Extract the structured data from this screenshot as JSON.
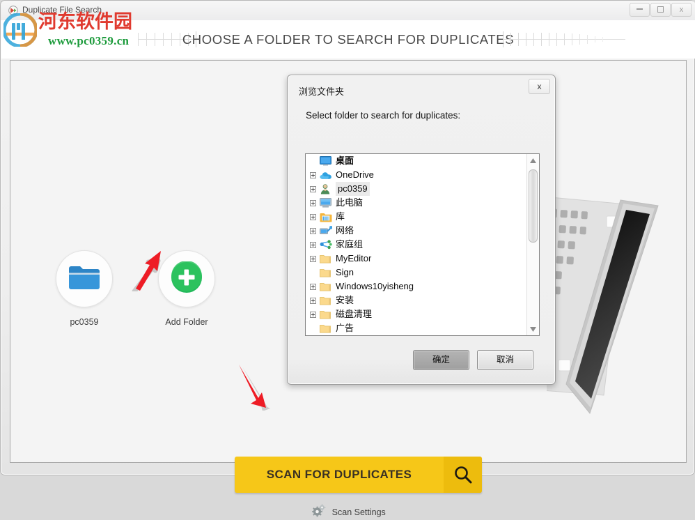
{
  "window": {
    "title": "Duplicate File Search",
    "app_icon": "app-icon",
    "minimize_label": "Minimize",
    "maximize_label": "Maximize",
    "close_label": "x"
  },
  "header": {
    "title": "CHOOSE A FOLDER TO SEARCH FOR DUPLICATES"
  },
  "watermark": {
    "site_name": "河东软件园",
    "url": "www.pc0359.cn"
  },
  "folders": [
    {
      "name": "pc0359",
      "icon": "blue-folder-icon"
    },
    {
      "name": "Add Folder",
      "icon": "green-plus-icon"
    }
  ],
  "scan": {
    "button_label": "SCAN FOR DUPLICATES",
    "button_icon": "magnifier-icon",
    "settings_label": "Scan Settings",
    "settings_icon": "gear-icon",
    "accent_color": "#f6c718",
    "accent_dark": "#edbc0d"
  },
  "dialog": {
    "title": "浏览文件夹",
    "close_label": "x",
    "prompt": "Select folder to search for duplicates:",
    "ok_label": "确定",
    "cancel_label": "取消",
    "tree": [
      {
        "label": "桌面",
        "icon": "desktop-icon",
        "expander": false,
        "root": true,
        "selected": false
      },
      {
        "label": "OneDrive",
        "icon": "onedrive-icon",
        "expander": true,
        "root": false,
        "selected": false
      },
      {
        "label": "pc0359",
        "icon": "user-icon",
        "expander": true,
        "root": false,
        "selected": true
      },
      {
        "label": "此电脑",
        "icon": "computer-icon",
        "expander": true,
        "root": false,
        "selected": false
      },
      {
        "label": "库",
        "icon": "library-icon",
        "expander": true,
        "root": false,
        "selected": false
      },
      {
        "label": "网络",
        "icon": "network-icon",
        "expander": true,
        "root": false,
        "selected": false
      },
      {
        "label": "家庭组",
        "icon": "homegroup-icon",
        "expander": true,
        "root": false,
        "selected": false
      },
      {
        "label": "MyEditor",
        "icon": "folder-icon",
        "expander": true,
        "root": false,
        "selected": false
      },
      {
        "label": "Sign",
        "icon": "folder-icon",
        "expander": false,
        "root": false,
        "selected": false
      },
      {
        "label": "Windows10yisheng",
        "icon": "folder-icon",
        "expander": true,
        "root": false,
        "selected": false
      },
      {
        "label": "安装",
        "icon": "folder-icon",
        "expander": true,
        "root": false,
        "selected": false
      },
      {
        "label": "磁盘清理",
        "icon": "folder-icon",
        "expander": true,
        "root": false,
        "selected": false
      },
      {
        "label": "广告",
        "icon": "folder-icon",
        "expander": false,
        "root": false,
        "selected": false
      }
    ]
  },
  "annotations": [
    {
      "name": "arrow-to-add-folder",
      "color": "#ee1c25"
    },
    {
      "name": "arrow-to-scan-button",
      "color": "#ee1c25"
    }
  ]
}
